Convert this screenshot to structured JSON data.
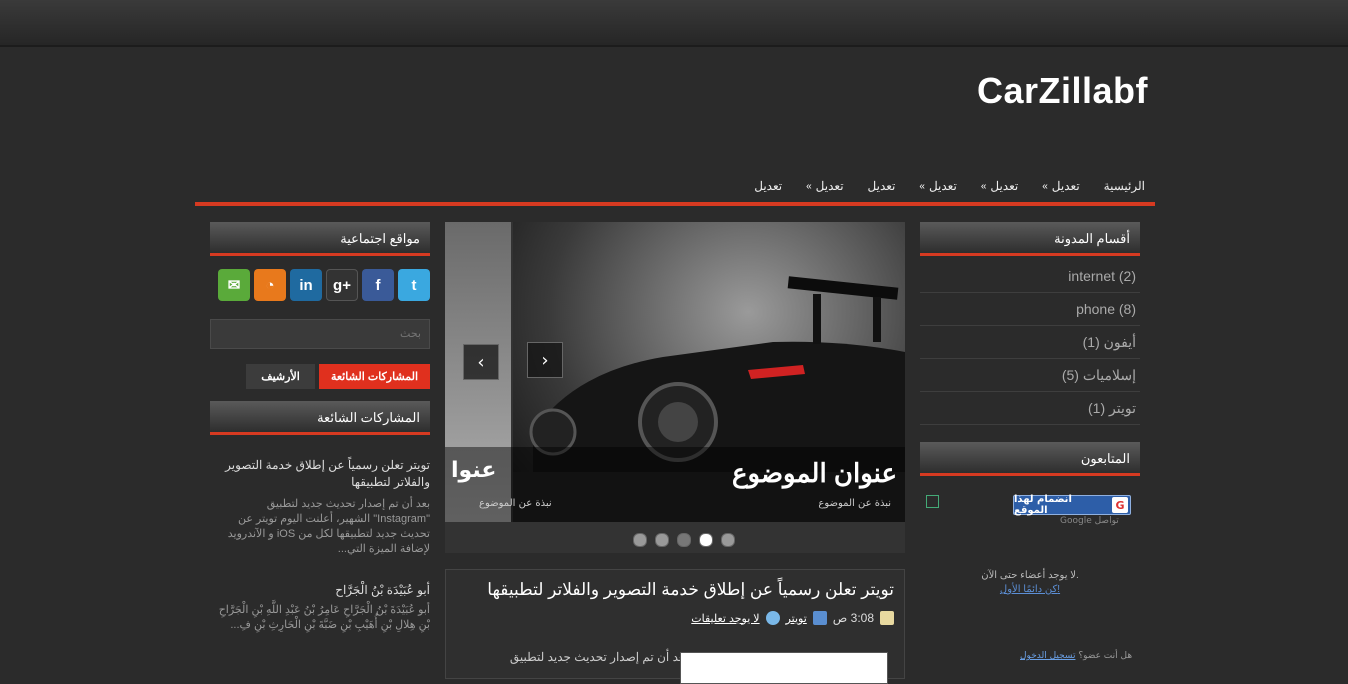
{
  "site": {
    "logo": "CarZillabf"
  },
  "nav": {
    "items": [
      {
        "label": "الرئيسية",
        "arrow": false
      },
      {
        "label": "تعديل",
        "arrow": true
      },
      {
        "label": "تعديل",
        "arrow": true
      },
      {
        "label": "تعديل",
        "arrow": true
      },
      {
        "label": "تعديل",
        "arrow": false
      },
      {
        "label": "تعديل",
        "arrow": true
      },
      {
        "label": "تعديل",
        "arrow": false
      }
    ]
  },
  "right_sidebar": {
    "categories_title": "أقسام المدونة",
    "categories": [
      {
        "label": "internet (2)"
      },
      {
        "label": "phone (8)"
      },
      {
        "label": "أيفون (1)"
      },
      {
        "label": "إسلاميات (5)"
      },
      {
        "label": "تويتر (1)"
      }
    ],
    "followers_title": "المتابعون",
    "follow_button": "انضمام لهذا الموقع",
    "gfc_label": "Google تواصل",
    "no_members": "لا يوجد أعضاء حتى الآن.",
    "be_first": "كن دائمًا الأول!",
    "login_prompt": "هل أنت عضو؟",
    "login_link": "تسجيل الدخول"
  },
  "left_sidebar": {
    "social_title": "مواقع اجتماعية",
    "social_icons": [
      "twitter-icon",
      "facebook-icon",
      "google-plus-icon",
      "linkedin-icon",
      "rss-icon",
      "email-icon"
    ],
    "search_placeholder": "بحث",
    "tabs": {
      "popular": "المشاركات الشائعة",
      "archive": "الأرشيف"
    },
    "popular_title": "المشاركات الشائعة",
    "popular_posts": [
      {
        "title": "تويتر تعلن رسمياً عن إطلاق خدمة التصوير والفلاتر لتطبيقها",
        "snippet": "بعد أن تم إصدار تحديث جديد لتطبيق \"Instagram\" الشهير، أعلنت اليوم تويتر عن تحديث جديد لتطبيقها لكل من iOS و الآندرويد لإضافة الميزة التي..."
      },
      {
        "title": "أبو عُبَيْدَة بْنُ الْجَرَّاح",
        "snippet": "أبو عُبَيْدَةَ بْنُ الْجَرَّاحِ عَامِرُ بْنُ عَبْدِ اللَّهِ بْنِ الْجَرَّاحِ بْنِ هِلالِ بْنِ أُهَيْبِ بْنِ ضَبَّةَ بْنِ الْحَارِثِ بْنِ فِ..."
      }
    ]
  },
  "slider": {
    "caption_main": "عنوان الموضوع",
    "caption_prev": "عنوا",
    "caption_sub_prev": "نبذة عن الموضوع",
    "caption_sub_main": "نبذة عن الموضوع",
    "dots": 5,
    "active_dot": 4
  },
  "post": {
    "title": "تويتر تعلن رسمياً عن إطلاق خدمة التصوير والفلاتر لتطبيقها",
    "time": "3:08 ص",
    "label": "تويتر",
    "comments": "لا يوجد تعليقات",
    "snippet": "بعد أن تم إصدار تحديث جديد لتطبيق"
  }
}
